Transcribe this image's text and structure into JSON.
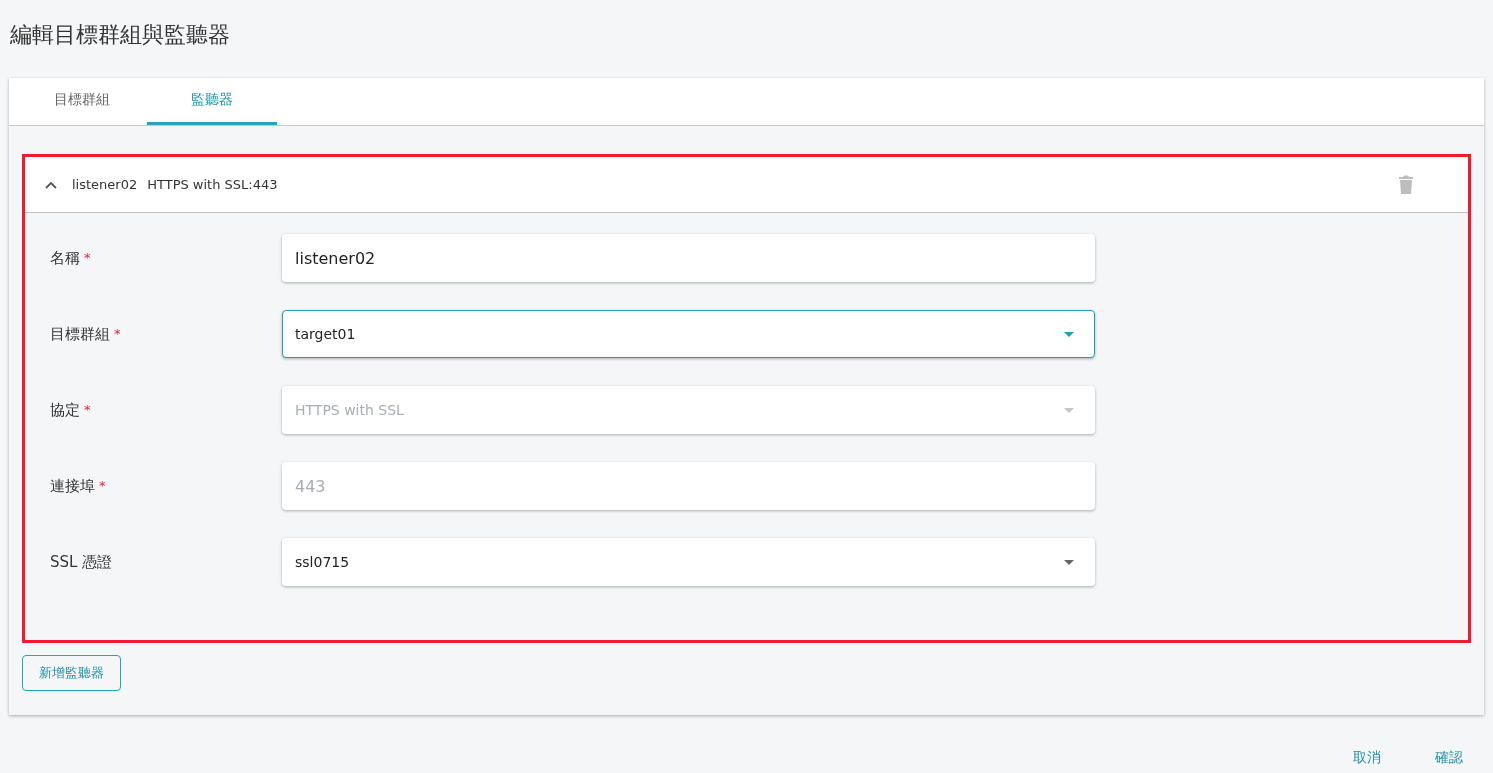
{
  "page_title": "編輯目標群組與監聽器",
  "tabs": [
    {
      "label": "目標群組",
      "selected": false
    },
    {
      "label": "監聽器",
      "selected": true
    }
  ],
  "listener": {
    "expanded": true,
    "name": "listener02",
    "summary": "HTTPS with SSL:443",
    "fields": [
      {
        "label": "名稱",
        "required_mark": "*",
        "kind": "input",
        "value": "listener02",
        "disabled": false,
        "focused": false
      },
      {
        "label": "目標群組",
        "required_mark": "*",
        "kind": "select",
        "value": "target01",
        "disabled": false,
        "focused": true
      },
      {
        "label": "協定",
        "required_mark": "*",
        "kind": "select",
        "value": "HTTPS with SSL",
        "disabled": true,
        "focused": false
      },
      {
        "label": "連接埠",
        "required_mark": "*",
        "kind": "input",
        "value": "443",
        "disabled": true,
        "focused": false
      },
      {
        "label": "SSL 憑證",
        "kind": "select",
        "value": "ssl0715",
        "disabled": false,
        "focused": false
      }
    ]
  },
  "add_button": "新增監聽器",
  "footer_buttons": [
    "取消",
    "確認"
  ]
}
